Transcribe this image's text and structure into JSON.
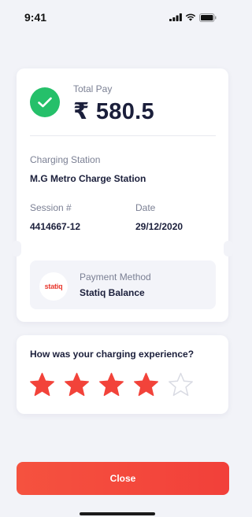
{
  "status_bar": {
    "time": "9:41"
  },
  "receipt": {
    "total_label": "Total Pay",
    "total_amount": "₹ 580.5",
    "station_label": "Charging Station",
    "station_value": "M.G Metro Charge Station",
    "session_label": "Session #",
    "session_value": "4414667-12",
    "date_label": "Date",
    "date_value": "29/12/2020"
  },
  "payment": {
    "logo_text": "statiq",
    "label": "Payment Method",
    "value": "Statiq Balance"
  },
  "rating": {
    "question": "How was your charging experience?",
    "stars_total": 5,
    "stars_selected": 4,
    "star_color": "#f2433a",
    "star_empty_color": "#d9dbe3"
  },
  "close_button": {
    "label": "Close"
  },
  "colors": {
    "accent": "#f2433a",
    "success": "#25c06a",
    "background": "#f2f3f8"
  }
}
